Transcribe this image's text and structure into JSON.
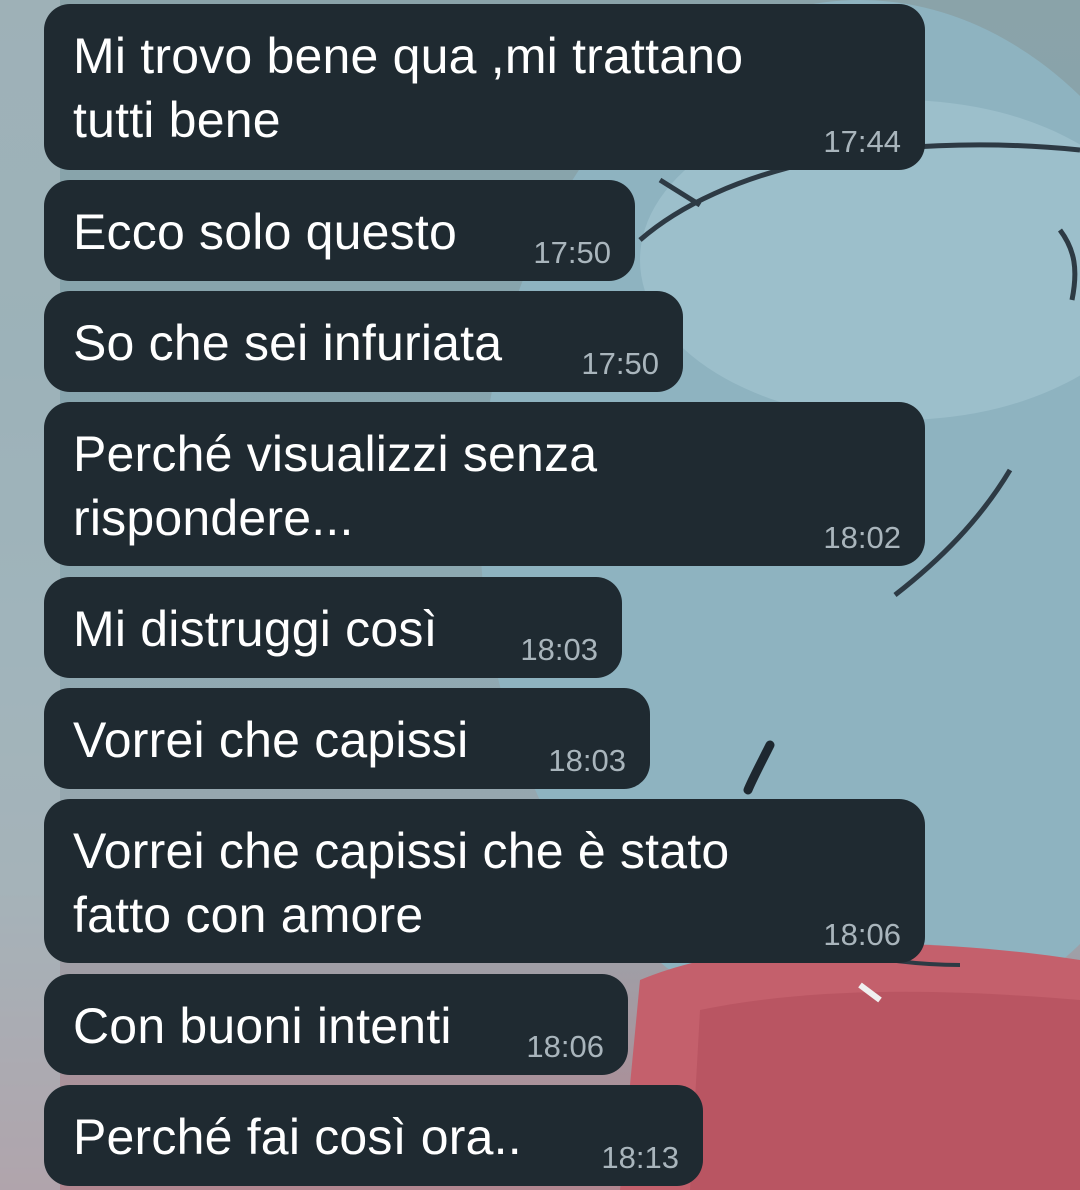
{
  "messages": [
    {
      "text": "Mi trovo bene qua ,mi trattano\ntutti bene",
      "time": "17:44"
    },
    {
      "text": "Ecco solo questo",
      "time": "17:50"
    },
    {
      "text": "So che sei infuriata",
      "time": "17:50"
    },
    {
      "text": "Perché visualizzi senza\nrispondere...",
      "time": "18:02"
    },
    {
      "text": "Mi distruggi così",
      "time": "18:03"
    },
    {
      "text": "Vorrei che capissi",
      "time": "18:03"
    },
    {
      "text": "Vorrei che capissi che è stato\nfatto con amore",
      "time": "18:06"
    },
    {
      "text": "Con buoni intenti",
      "time": "18:06"
    },
    {
      "text": "Perché fai così ora..",
      "time": "18:13"
    }
  ],
  "colors": {
    "bubble": "#1f2a31",
    "text": "#ffffff",
    "time": "#a9b5bc"
  }
}
